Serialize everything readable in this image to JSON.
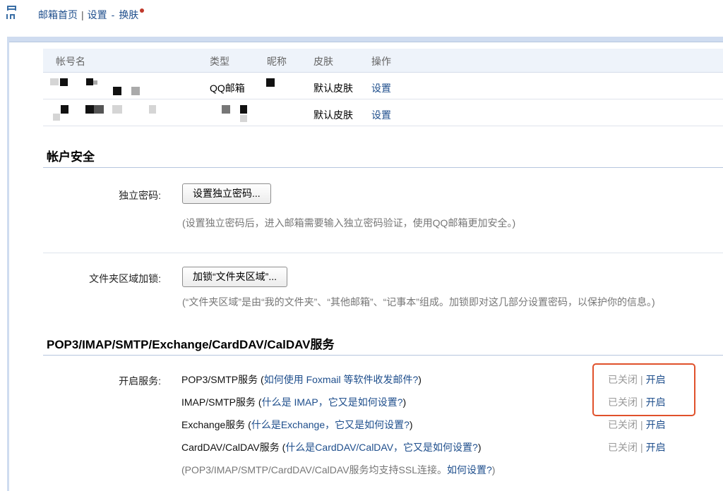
{
  "breadcrumb": {
    "home": "邮箱首页",
    "sep": "|",
    "settings": "设置",
    "dash": "-",
    "current": "换肤"
  },
  "accounts": {
    "headers": [
      "帐号名",
      "类型",
      "昵称",
      "皮肤",
      "操作"
    ],
    "rows": [
      {
        "type": "QQ邮箱",
        "skin": "默认皮肤",
        "action": "设置"
      },
      {
        "type": "",
        "skin": "默认皮肤",
        "action": "设置"
      }
    ]
  },
  "security": {
    "title": "帐户安全",
    "password_label": "独立密码:",
    "password_button": "设置独立密码...",
    "password_note": "(设置独立密码后，进入邮箱需要输入独立密码验证，使用QQ邮箱更加安全。)",
    "folder_label": "文件夹区域加锁:",
    "folder_button": "加锁“文件夹区域”...",
    "folder_note": "(“文件夹区域”是由“我的文件夹”、“其他邮箱”、“记事本”组成。加锁即对这几部分设置密码，以保护你的信息。)"
  },
  "services": {
    "title": "POP3/IMAP/SMTP/Exchange/CardDAV/CalDAV服务",
    "label": "开启服务:",
    "items": [
      {
        "name": "POP3/SMTP服务",
        "open": " (",
        "help": "如何使用 Foxmail 等软件收发邮件?",
        "close": ")",
        "status": "已关闭",
        "sep": "|",
        "action": "开启"
      },
      {
        "name": "IMAP/SMTP服务",
        "open": " (",
        "help": "什么是 IMAP，它又是如何设置?",
        "close": ")",
        "status": "已关闭",
        "sep": "|",
        "action": "开启"
      },
      {
        "name": "Exchange服务",
        "open": " (",
        "help": "什么是Exchange，它又是如何设置?",
        "close": ")",
        "status": "已关闭",
        "sep": "|",
        "action": "开启"
      },
      {
        "name": "CardDAV/CalDAV服务",
        "open": " (",
        "help": "什么是CardDAV/CalDAV，它又是如何设置?",
        "close": ")",
        "status": "已关闭",
        "sep": "|",
        "action": "开启"
      }
    ],
    "ssl_note": "(POP3/IMAP/SMTP/CardDAV/CalDAV服务均支持SSL连接。",
    "ssl_link": "如何设置?",
    "ssl_close": ")"
  },
  "colors": {
    "link": "#1e4e8c",
    "highlight_border": "#e0512b",
    "frame": "#cfdcf0"
  }
}
